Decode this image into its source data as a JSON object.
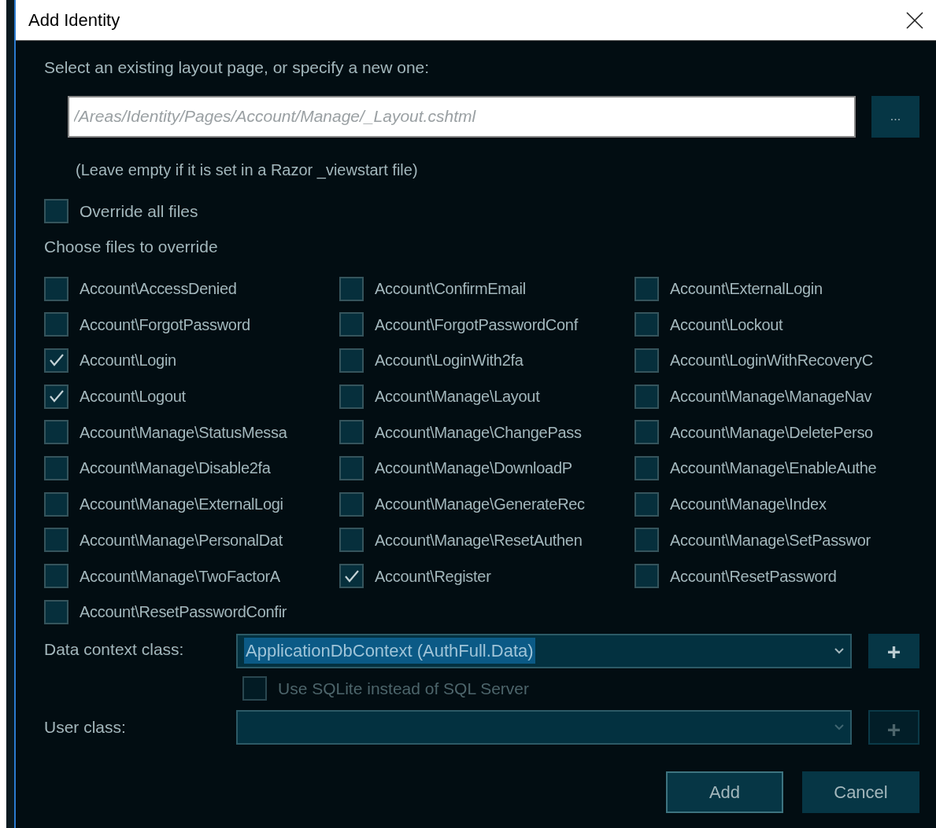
{
  "window": {
    "title": "Add Identity"
  },
  "layout_prompt": "Select an existing layout page, or specify a new one:",
  "layout_field": {
    "placeholder": "/Areas/Identity/Pages/Account/Manage/_Layout.cshtml"
  },
  "browse_button": "...",
  "layout_hint": "(Leave empty if it is set in a Razor _viewstart file)",
  "override_all": {
    "label": "Override all files",
    "checked": false
  },
  "files_heading": "Choose files to override",
  "files": [
    {
      "label": "Account\\AccessDenied",
      "checked": false
    },
    {
      "label": "Account\\ConfirmEmail",
      "checked": false
    },
    {
      "label": "Account\\ExternalLogin",
      "checked": false
    },
    {
      "label": "Account\\ForgotPassword",
      "checked": false
    },
    {
      "label": "Account\\ForgotPasswordConf",
      "checked": false
    },
    {
      "label": "Account\\Lockout",
      "checked": false
    },
    {
      "label": "Account\\Login",
      "checked": true
    },
    {
      "label": "Account\\LoginWith2fa",
      "checked": false
    },
    {
      "label": "Account\\LoginWithRecoveryC",
      "checked": false
    },
    {
      "label": "Account\\Logout",
      "checked": true
    },
    {
      "label": "Account\\Manage\\Layout",
      "checked": false
    },
    {
      "label": "Account\\Manage\\ManageNav",
      "checked": false
    },
    {
      "label": "Account\\Manage\\StatusMessa",
      "checked": false
    },
    {
      "label": "Account\\Manage\\ChangePass",
      "checked": false
    },
    {
      "label": "Account\\Manage\\DeletePerso",
      "checked": false
    },
    {
      "label": "Account\\Manage\\Disable2fa",
      "checked": false
    },
    {
      "label": "Account\\Manage\\DownloadP",
      "checked": false
    },
    {
      "label": "Account\\Manage\\EnableAuthe",
      "checked": false
    },
    {
      "label": "Account\\Manage\\ExternalLogi",
      "checked": false
    },
    {
      "label": "Account\\Manage\\GenerateRec",
      "checked": false
    },
    {
      "label": "Account\\Manage\\Index",
      "checked": false
    },
    {
      "label": "Account\\Manage\\PersonalDat",
      "checked": false
    },
    {
      "label": "Account\\Manage\\ResetAuthen",
      "checked": false
    },
    {
      "label": "Account\\Manage\\SetPasswor",
      "checked": false
    },
    {
      "label": "Account\\Manage\\TwoFactorA",
      "checked": false
    },
    {
      "label": "Account\\Register",
      "checked": true
    },
    {
      "label": "Account\\ResetPassword",
      "checked": false
    },
    {
      "label": "Account\\ResetPasswordConfir",
      "checked": false
    }
  ],
  "data_context": {
    "label": "Data context class:",
    "value": "ApplicationDbContext (AuthFull.Data)",
    "selected": true,
    "disabled": false,
    "add_button": "+"
  },
  "use_sqlite": {
    "label": "Use SQLite instead of SQL Server",
    "checked": false,
    "disabled": true
  },
  "user_class": {
    "label": "User class:",
    "disabled": true,
    "add_button": "+"
  },
  "buttons": [
    {
      "label": "Add",
      "focused": true
    },
    {
      "label": "Cancel",
      "focused": false
    }
  ]
}
